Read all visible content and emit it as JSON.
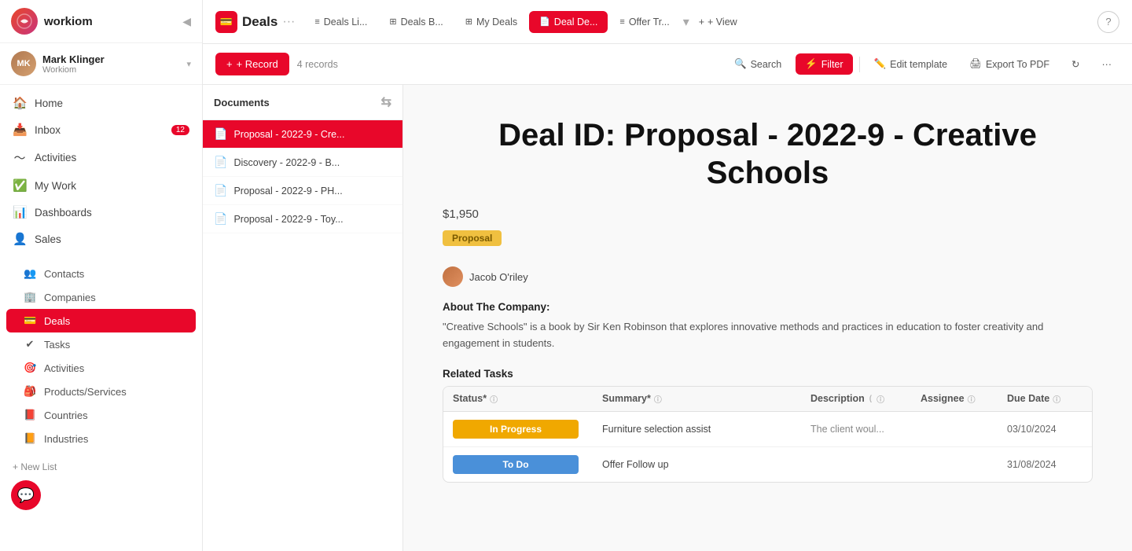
{
  "app": {
    "brand": "workiom",
    "logo_text": "W"
  },
  "user": {
    "name": "Mark Klinger",
    "role": "Workiom",
    "avatar_initials": "MK"
  },
  "sidebar": {
    "nav_items": [
      {
        "id": "home",
        "label": "Home",
        "icon": "🏠",
        "active": false
      },
      {
        "id": "inbox",
        "label": "Inbox",
        "icon": "📥",
        "badge": "12",
        "active": false
      },
      {
        "id": "activities",
        "label": "Activities",
        "icon": "〜",
        "active": false
      },
      {
        "id": "mywork",
        "label": "My Work",
        "icon": "✅",
        "active": false
      },
      {
        "id": "dashboards",
        "label": "Dashboards",
        "icon": "📊",
        "active": false
      },
      {
        "id": "sales",
        "label": "Sales",
        "icon": "👤",
        "active": false
      }
    ],
    "sub_items": [
      {
        "id": "contacts",
        "label": "Contacts",
        "icon": "👥",
        "active": false
      },
      {
        "id": "companies",
        "label": "Companies",
        "icon": "🏢",
        "active": false
      },
      {
        "id": "deals",
        "label": "Deals",
        "icon": "💳",
        "active": true
      },
      {
        "id": "tasks",
        "label": "Tasks",
        "icon": "✔",
        "active": false
      },
      {
        "id": "activities_sub",
        "label": "Activities",
        "icon": "🎯",
        "active": false
      },
      {
        "id": "products",
        "label": "Products/Services",
        "icon": "🎒",
        "active": false
      },
      {
        "id": "countries",
        "label": "Countries",
        "icon": "📕",
        "active": false
      },
      {
        "id": "industries",
        "label": "Industries",
        "icon": "📙",
        "active": false
      }
    ],
    "new_list_label": "+ New List"
  },
  "topbar": {
    "module_icon": "💳",
    "module_title": "Deals",
    "tabs": [
      {
        "id": "deals-list",
        "label": "Deals Li...",
        "icon": "≡",
        "active": false
      },
      {
        "id": "deals-board",
        "label": "Deals B...",
        "icon": "⊞",
        "active": false
      },
      {
        "id": "my-deals",
        "label": "My Deals",
        "icon": "⊞",
        "active": false
      },
      {
        "id": "deal-detail",
        "label": "Deal De...",
        "icon": "📄",
        "active": true
      },
      {
        "id": "offer-tracker",
        "label": "Offer Tr...",
        "icon": "≡",
        "active": false
      }
    ],
    "add_view_label": "+ View",
    "help_icon": "?"
  },
  "toolbar": {
    "record_label": "+ Record",
    "record_count": "4 records",
    "search_label": "Search",
    "filter_label": "Filter",
    "edit_template_label": "Edit template",
    "export_pdf_label": "Export To PDF"
  },
  "documents": {
    "panel_title": "Documents",
    "items": [
      {
        "id": "doc1",
        "label": "Proposal - 2022-9 - Cre...",
        "active": true
      },
      {
        "id": "doc2",
        "label": "Discovery - 2022-9 - B...",
        "active": false
      },
      {
        "id": "doc3",
        "label": "Proposal - 2022-9 - PH...",
        "active": false
      },
      {
        "id": "doc4",
        "label": "Proposal - 2022-9 - Toy...",
        "active": false
      }
    ]
  },
  "detail": {
    "title": "Deal ID: Proposal - 2022-9 - Creative Schools",
    "amount": "$1,950",
    "badge_label": "Proposal",
    "assignee_name": "Jacob O'riley",
    "about_title": "About The Company:",
    "about_text": "\"Creative Schools\" is a book by Sir Ken Robinson that explores innovative methods and practices in education to foster creativity and engagement in students.",
    "related_tasks_title": "Related Tasks",
    "tasks_table": {
      "columns": [
        {
          "id": "status",
          "label": "Status*"
        },
        {
          "id": "summary",
          "label": "Summary*"
        },
        {
          "id": "description",
          "label": "Description"
        },
        {
          "id": "assignee",
          "label": "Assignee"
        },
        {
          "id": "due_date",
          "label": "Due Date"
        }
      ],
      "rows": [
        {
          "status": "In Progress",
          "status_type": "inprogress",
          "summary": "Furniture selection assist",
          "description": "The client woul...",
          "assignee": "",
          "due_date": "03/10/2024"
        },
        {
          "status": "To Do",
          "status_type": "todo",
          "summary": "Offer Follow up",
          "description": "",
          "assignee": "",
          "due_date": "31/08/2024"
        }
      ]
    }
  }
}
